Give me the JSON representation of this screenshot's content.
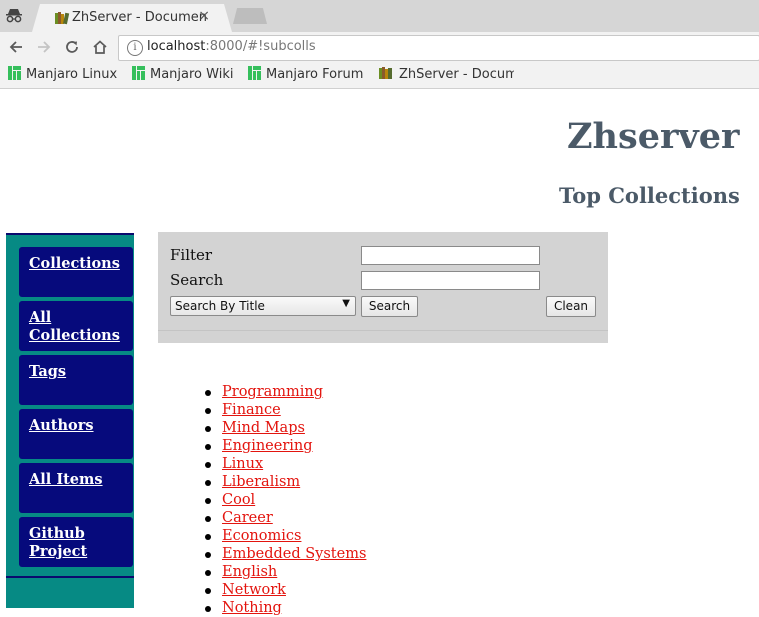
{
  "browser": {
    "tab_title": "ZhServer - Documen",
    "tab_close": "×",
    "url_host": "localhost",
    "url_rest": ":8000/#!subcolls",
    "bookmarks": [
      "Manjaro Linux",
      "Manjaro Wiki",
      "Manjaro Forum",
      "ZhServer - Docum"
    ]
  },
  "page": {
    "site_title": "Zhserver",
    "section_title": "Top Collections"
  },
  "sidebar": {
    "items": [
      "Collections",
      "All Collections",
      "Tags",
      "Authors",
      "All Items",
      "Github Project"
    ]
  },
  "search_panel": {
    "filter_label": "Filter",
    "search_label": "Search",
    "filter_value": "",
    "search_value": "",
    "search_mode": "Search By Title",
    "search_button": "Search",
    "clean_button": "Clean"
  },
  "collections": [
    "Programming",
    "Finance",
    "Mind Maps",
    "Engineering",
    "Linux",
    "Liberalism",
    "Cool",
    "Career",
    "Economics",
    "Embedded Systems",
    "English",
    "Network",
    "Nothing"
  ]
}
